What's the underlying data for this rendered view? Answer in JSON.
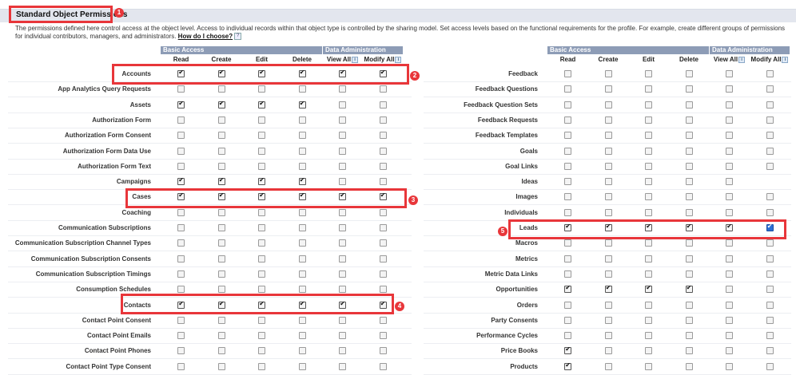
{
  "section": {
    "title": "Standard Object Permissions",
    "description": "The permissions defined here control access at the object level. Access to individual records within that object type is controlled by the sharing model. Set access levels based on the functional requirements for the profile. For example, create different groups of permissions for individual contributors, managers, and administrators.",
    "help_link": "How do I choose?",
    "help_icon": "?"
  },
  "headers": {
    "basic_access": "Basic Access",
    "data_admin": "Data Administration",
    "columns": [
      "Read",
      "Create",
      "Edit",
      "Delete",
      "View All",
      "Modify All"
    ],
    "info_icon": "i"
  },
  "left": {
    "rows": [
      {
        "label": "Accounts",
        "checks": [
          1,
          1,
          1,
          1,
          1,
          1
        ]
      },
      {
        "label": "App Analytics Query Requests",
        "checks": [
          0,
          0,
          0,
          0,
          0,
          0
        ]
      },
      {
        "label": "Assets",
        "checks": [
          1,
          1,
          1,
          1,
          0,
          0
        ]
      },
      {
        "label": "Authorization Form",
        "checks": [
          0,
          0,
          0,
          0,
          0,
          0
        ]
      },
      {
        "label": "Authorization Form Consent",
        "checks": [
          0,
          0,
          0,
          0,
          0,
          0
        ]
      },
      {
        "label": "Authorization Form Data Use",
        "checks": [
          0,
          0,
          0,
          0,
          0,
          0
        ]
      },
      {
        "label": "Authorization Form Text",
        "checks": [
          0,
          0,
          0,
          0,
          0,
          0
        ]
      },
      {
        "label": "Campaigns",
        "checks": [
          1,
          1,
          1,
          1,
          0,
          0
        ]
      },
      {
        "label": "Cases",
        "checks": [
          1,
          1,
          1,
          1,
          1,
          1
        ]
      },
      {
        "label": "Coaching",
        "checks": [
          0,
          0,
          0,
          0,
          0,
          0
        ]
      },
      {
        "label": "Communication Subscriptions",
        "checks": [
          0,
          0,
          0,
          0,
          0,
          0
        ]
      },
      {
        "label": "Communication Subscription Channel Types",
        "checks": [
          0,
          0,
          0,
          0,
          0,
          0
        ]
      },
      {
        "label": "Communication Subscription Consents",
        "checks": [
          0,
          0,
          0,
          0,
          0,
          0
        ]
      },
      {
        "label": "Communication Subscription Timings",
        "checks": [
          0,
          0,
          0,
          0,
          0,
          0
        ]
      },
      {
        "label": "Consumption Schedules",
        "checks": [
          0,
          0,
          0,
          0,
          0,
          0
        ]
      },
      {
        "label": "Contacts",
        "checks": [
          1,
          1,
          1,
          1,
          1,
          1
        ]
      },
      {
        "label": "Contact Point Consent",
        "checks": [
          0,
          0,
          0,
          0,
          0,
          0
        ]
      },
      {
        "label": "Contact Point Emails",
        "checks": [
          0,
          0,
          0,
          0,
          0,
          0
        ]
      },
      {
        "label": "Contact Point Phones",
        "checks": [
          0,
          0,
          0,
          0,
          0,
          0
        ]
      },
      {
        "label": "Contact Point Type Consent",
        "checks": [
          0,
          0,
          0,
          0,
          0,
          0
        ]
      }
    ]
  },
  "right": {
    "rows": [
      {
        "label": "Feedback",
        "checks": [
          0,
          0,
          0,
          0,
          0,
          0
        ]
      },
      {
        "label": "Feedback Questions",
        "checks": [
          0,
          0,
          0,
          0,
          0,
          0
        ]
      },
      {
        "label": "Feedback Question Sets",
        "checks": [
          0,
          0,
          0,
          0,
          0,
          0
        ]
      },
      {
        "label": "Feedback Requests",
        "checks": [
          0,
          0,
          0,
          0,
          0,
          0
        ]
      },
      {
        "label": "Feedback Templates",
        "checks": [
          0,
          0,
          0,
          0,
          0,
          0
        ]
      },
      {
        "label": "Goals",
        "checks": [
          0,
          0,
          0,
          0,
          0,
          0
        ]
      },
      {
        "label": "Goal Links",
        "checks": [
          0,
          0,
          0,
          0,
          0,
          0
        ]
      },
      {
        "label": "Ideas",
        "checks": [
          0,
          0,
          0,
          0,
          0,
          null
        ]
      },
      {
        "label": "Images",
        "checks": [
          0,
          0,
          0,
          0,
          0,
          0
        ]
      },
      {
        "label": "Individuals",
        "checks": [
          0,
          0,
          0,
          0,
          0,
          0
        ]
      },
      {
        "label": "Leads",
        "checks": [
          1,
          1,
          1,
          1,
          1,
          1
        ]
      },
      {
        "label": "Macros",
        "checks": [
          0,
          0,
          0,
          0,
          0,
          0
        ]
      },
      {
        "label": "Metrics",
        "checks": [
          0,
          0,
          0,
          0,
          0,
          0
        ]
      },
      {
        "label": "Metric Data Links",
        "checks": [
          0,
          0,
          0,
          0,
          0,
          0
        ]
      },
      {
        "label": "Opportunities",
        "checks": [
          1,
          1,
          1,
          1,
          0,
          0
        ]
      },
      {
        "label": "Orders",
        "checks": [
          0,
          0,
          0,
          0,
          0,
          0
        ]
      },
      {
        "label": "Party Consents",
        "checks": [
          0,
          0,
          0,
          0,
          0,
          0
        ]
      },
      {
        "label": "Performance Cycles",
        "checks": [
          0,
          0,
          0,
          0,
          0,
          0
        ]
      },
      {
        "label": "Price Books",
        "checks": [
          1,
          0,
          0,
          0,
          0,
          0
        ]
      },
      {
        "label": "Products",
        "checks": [
          1,
          0,
          0,
          0,
          0,
          0
        ]
      }
    ]
  },
  "annotations": [
    "1",
    "2",
    "3",
    "4",
    "5"
  ],
  "colors": {
    "highlight": "#e8363a",
    "group_header": "#8d9cb6",
    "section_bar": "#e3e6ee"
  }
}
